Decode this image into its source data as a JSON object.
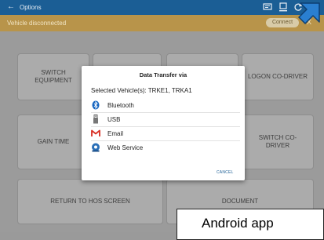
{
  "topbar": {
    "back_icon": "arrow-left-icon",
    "title": "Options",
    "icons": [
      "dialog-icon",
      "transfer-icon",
      "refresh-icon",
      "menu-icon"
    ],
    "background": "#1b5e95"
  },
  "status": {
    "message": "Vehicle disconnected",
    "connect_label": "Connect",
    "close_glyph": "X",
    "background": "#b8944a"
  },
  "tiles": {
    "switch_equipment": "SWITCH EQUIPMENT",
    "logon_co_driver": "LOGON CO-DRIVER",
    "gain_time": "GAIN TIME",
    "switch_co_driver": "SWITCH CO-DRIVER",
    "return_hos": "RETURN TO HOS SCREEN",
    "document": "DOCUMENT"
  },
  "dialog": {
    "title": "Data Transfer via",
    "selected": "Selected Vehicle(s): TRKE1, TRKA1",
    "options": [
      {
        "label": "Bluetooth",
        "icon": "bluetooth-icon"
      },
      {
        "label": "USB",
        "icon": "usb-icon"
      },
      {
        "label": "Email",
        "icon": "gmail-icon"
      },
      {
        "label": "Web Service",
        "icon": "web-service-icon"
      }
    ],
    "cancel_label": "CANCEL"
  },
  "callout": {
    "text": "Android app"
  },
  "colors": {
    "accent": "#1b5e95",
    "warning_bar": "#b8944a",
    "callout_arrow": "#2a7fd0"
  }
}
